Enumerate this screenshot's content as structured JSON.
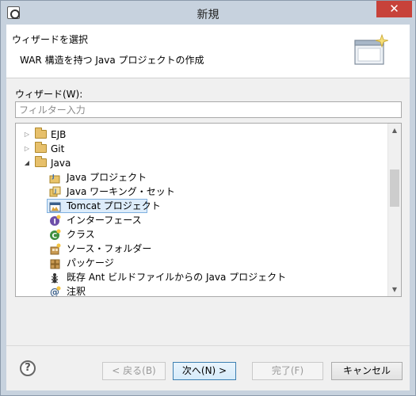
{
  "window": {
    "title": "新規",
    "close_glyph": "✕"
  },
  "banner": {
    "title": "ウィザードを選択",
    "description": "WAR 構造を持つ Java プロジェクトの作成"
  },
  "wizard_label": "ウィザード(W):",
  "filter": {
    "placeholder": "フィルター入力",
    "value": ""
  },
  "tree": {
    "nodes": [
      {
        "label": "EJB",
        "icon": "folder-icon",
        "state": "collapsed"
      },
      {
        "label": "Git",
        "icon": "folder-icon",
        "state": "collapsed"
      },
      {
        "label": "Java",
        "icon": "folder-icon",
        "state": "expanded"
      }
    ],
    "java_children": [
      {
        "label": "Java プロジェクト",
        "icon": "java-project-icon"
      },
      {
        "label": "Java ワーキング・セット",
        "icon": "working-set-icon"
      },
      {
        "label": "Tomcat プロジェクト",
        "icon": "tomcat-project-icon",
        "selected": true
      },
      {
        "label": "インターフェース",
        "icon": "interface-icon"
      },
      {
        "label": "クラス",
        "icon": "class-icon"
      },
      {
        "label": "ソース・フォルダー",
        "icon": "source-folder-icon"
      },
      {
        "label": "パッケージ",
        "icon": "package-icon"
      },
      {
        "label": "既存 Ant ビルドファイルからの Java プロジェクト",
        "icon": "ant-icon"
      },
      {
        "label": "注釈",
        "icon": "annotation-icon"
      }
    ]
  },
  "buttons": {
    "back": "< 戻る(B)",
    "next": "次へ(N) >",
    "finish": "完了(F)",
    "cancel": "キャンセル",
    "help": "?"
  },
  "colors": {
    "accent": "#3c7fb1",
    "selection": "#ddecfa",
    "close_button": "#c7423a"
  }
}
